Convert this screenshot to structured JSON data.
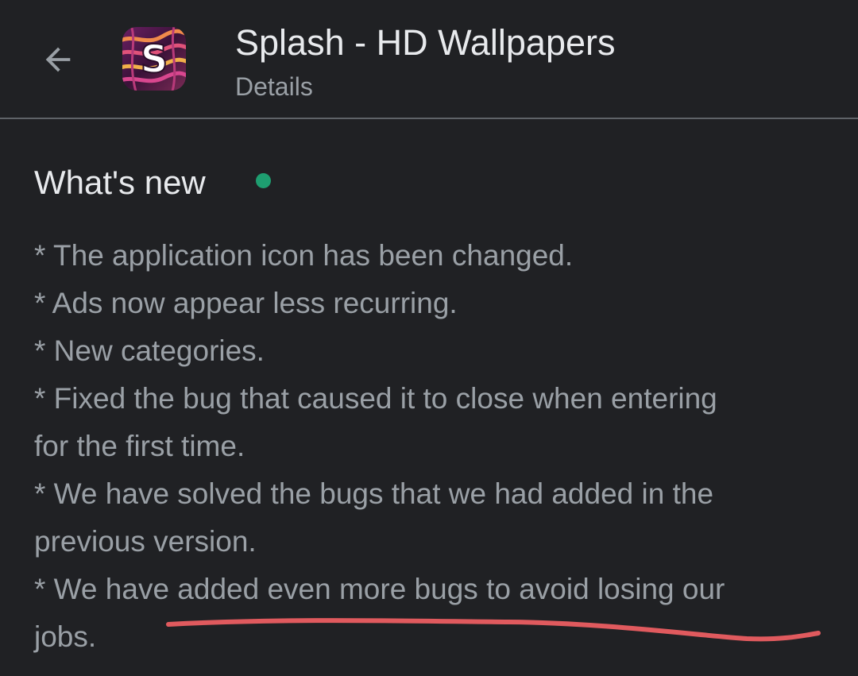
{
  "header": {
    "back_icon": "arrow-back-icon",
    "app_icon": "splash-app-icon",
    "app_icon_letter": "S",
    "title": "Splash - HD Wallpapers",
    "subtitle": "Details"
  },
  "section": {
    "title": "What's new",
    "indicator_color": "#1e9e70",
    "lines": [
      "* The application icon has been changed.",
      "* Ads now appear less recurring.",
      "* New categories.",
      "* Fixed the bug that caused it to close when entering",
      "for the first time.",
      "* We have solved the bugs that we had added in the",
      "previous version.",
      "* We have added even more bugs to avoid losing our",
      "jobs."
    ]
  },
  "annotation": {
    "underline_color": "#e05a5e"
  },
  "colors": {
    "background": "#202124",
    "primary_text": "#e8eaed",
    "secondary_text": "#9aa0a6",
    "divider": "#5f6368"
  }
}
